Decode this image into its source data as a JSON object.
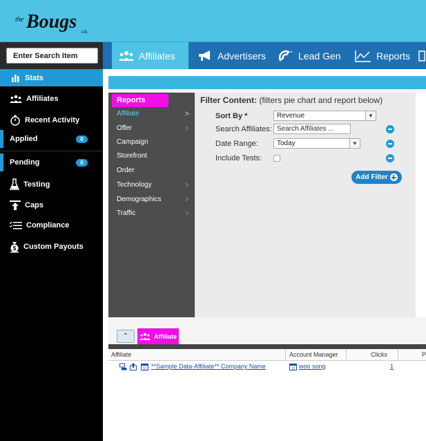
{
  "brand": {
    "logo_text": "Bougs",
    "logo_prefix": "the",
    "logo_suffix": "co."
  },
  "search": {
    "placeholder": "Enter Search Item"
  },
  "nav": {
    "tabs": [
      {
        "label": "Affiliates",
        "icon": "people-icon",
        "active": true
      },
      {
        "label": "Advertisers",
        "icon": "megaphone-icon",
        "active": false
      },
      {
        "label": "Lead Gen",
        "icon": "magnet-icon",
        "active": false
      },
      {
        "label": "Reports",
        "icon": "line-chart-icon",
        "active": false
      }
    ]
  },
  "sidebar": {
    "items": [
      {
        "label": "Stats",
        "icon": "bar-chart-icon"
      },
      {
        "label": "Affiliates",
        "icon": "people-icon"
      },
      {
        "label": "Recent Activity",
        "icon": "stopwatch-icon"
      },
      {
        "label": "Applied",
        "count": "0"
      },
      {
        "label": "Pending",
        "count": "0"
      },
      {
        "label": "Testing",
        "icon": "flask-icon"
      },
      {
        "label": "Caps",
        "icon": "cap-arrow-icon"
      },
      {
        "label": "Compliance",
        "icon": "checklist-icon"
      },
      {
        "label": "Custom Payouts",
        "icon": "money-bag-icon"
      }
    ]
  },
  "reports_menu": {
    "title": "Reports",
    "items": [
      {
        "label": "Affiliate",
        "has_submenu": true,
        "active": true
      },
      {
        "label": "Offer",
        "has_submenu": true
      },
      {
        "label": "Campaign",
        "has_submenu": false
      },
      {
        "label": "Storefront",
        "has_submenu": false
      },
      {
        "label": "Order",
        "has_submenu": false
      },
      {
        "label": "Technology",
        "has_submenu": true
      },
      {
        "label": "Demographics",
        "has_submenu": true
      },
      {
        "label": "Traffic",
        "has_submenu": true
      }
    ]
  },
  "filter": {
    "heading_bold": "Filter Content:",
    "heading_rest": " (filters pie chart and report below)",
    "sort_by_label": "Sort By *",
    "sort_by_value": "Revenue",
    "search_label": "Search Affiliates:",
    "search_placeholder": "Search Affiliates ...",
    "date_label": "Date Range:",
    "date_value": "Today",
    "tests_label": "Include Tests:",
    "tests_checked": false,
    "add_filter_label": "Add Filter"
  },
  "results": {
    "tab_label": "Affiliate",
    "columns": [
      "Affiliate",
      "Account Manager",
      "Clicks",
      "P"
    ],
    "rows": [
      {
        "affiliate": "**Sample Data-Affiliate** Company Name",
        "account_manager": "woo song",
        "clicks": "1"
      }
    ]
  },
  "colors": {
    "header_bg": "#4ec3e6",
    "nav_bg": "#1f6fb3",
    "accent_blue": "#1f9ad6",
    "magenta": "#f10fe7",
    "sidebar_bg": "#000000",
    "link": "#1b4fa8"
  }
}
